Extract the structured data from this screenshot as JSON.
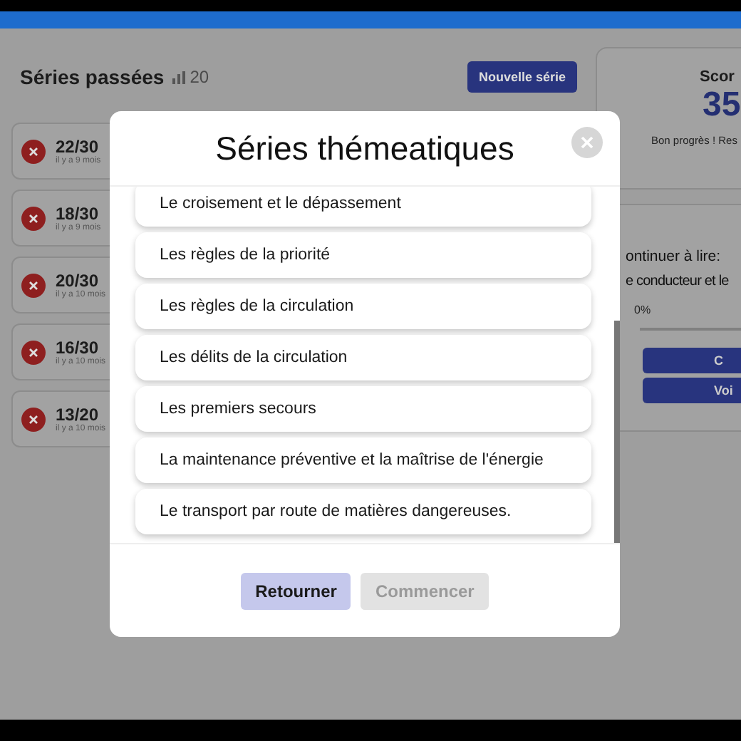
{
  "history": {
    "title": "Séries passées",
    "count": "20",
    "new_button": "Nouvelle série",
    "items": [
      {
        "score": "22/30",
        "time": "il y a 9 mois",
        "passed": false
      },
      {
        "score": "18/30",
        "time": "il y a 9 mois",
        "passed": false
      },
      {
        "score": "20/30",
        "time": "il y a 10 mois",
        "passed": false
      },
      {
        "score": "16/30",
        "time": "il y a 10 mois",
        "passed": false
      },
      {
        "score": "13/20",
        "time": "il y a 10 mois",
        "passed": false
      }
    ]
  },
  "score_card": {
    "title": "Scor",
    "value": "35",
    "message": "Bon progrès ! Res"
  },
  "reading_card": {
    "label": "ontinuer à lire:",
    "chapter": "e conducteur et le",
    "percent": "0%",
    "level": 0,
    "buttons": [
      "C",
      "Voi"
    ]
  },
  "modal": {
    "title": "Séries thémeatiques",
    "themes": [
      {
        "label": "Le croisement et le dépassement",
        "selected": false
      },
      {
        "label": "Les règles de la priorité",
        "selected": false
      },
      {
        "label": "Les règles de la circulation",
        "selected": false
      },
      {
        "label": "Les délits de la circulation",
        "selected": false
      },
      {
        "label": "Les premiers secours",
        "selected": false
      },
      {
        "label": "La maintenance préventive et la maîtrise de l'énergie",
        "selected": false
      },
      {
        "label": "Le transport par route de matières dangereuses.",
        "selected": false
      }
    ],
    "buttons": [
      {
        "label": "Retourner",
        "disabled": false
      },
      {
        "label": "Commencer",
        "disabled": true
      }
    ]
  }
}
